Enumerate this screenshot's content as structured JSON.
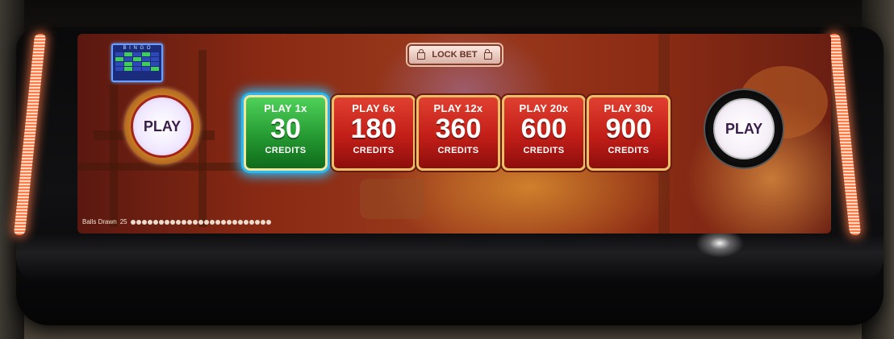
{
  "lock_bet": {
    "label": "LOCK BET",
    "icon": "lock-icon"
  },
  "bingo_card": {
    "header": "B I N G O"
  },
  "play_left": {
    "label": "PLAY"
  },
  "play_right": {
    "label": "PLAY"
  },
  "bets": [
    {
      "multiplier": "PLAY 1x",
      "amount": "30",
      "unit": "CREDITS",
      "selected": true
    },
    {
      "multiplier": "PLAY 6x",
      "amount": "180",
      "unit": "CREDITS",
      "selected": false
    },
    {
      "multiplier": "PLAY 12x",
      "amount": "360",
      "unit": "CREDITS",
      "selected": false
    },
    {
      "multiplier": "PLAY 20x",
      "amount": "600",
      "unit": "CREDITS",
      "selected": false
    },
    {
      "multiplier": "PLAY 30x",
      "amount": "900",
      "unit": "CREDITS",
      "selected": false
    }
  ],
  "status": {
    "balls_drawn_label": "Balls Drawn",
    "balls_drawn_count": "25"
  },
  "colors": {
    "selected_bet": "#259a32",
    "bet": "#c21e18",
    "selected_glow": "#23c0ff",
    "led": "#ff7a4a"
  }
}
